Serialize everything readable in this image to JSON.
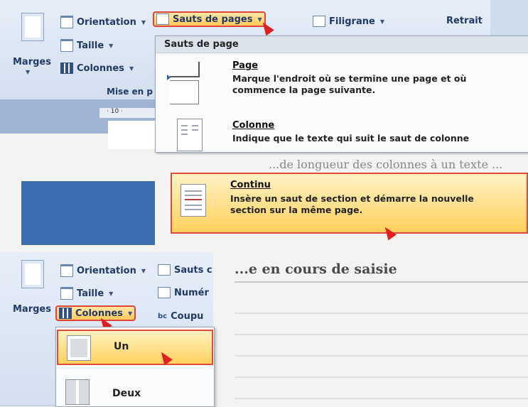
{
  "ribbon_top": {
    "orientation": "Orientation",
    "taille": "Taille",
    "colonnes": "Colonnes",
    "marges": "Marges",
    "sauts": "Sauts de pages",
    "filigrane": "Filigrane",
    "retrait": "Retrait",
    "group": "Mise en p"
  },
  "breaks_menu": {
    "header": "Sauts de page",
    "items": [
      {
        "title": "Page",
        "desc1": "Marque l'endroit où se termine une page et où",
        "desc2": "commence la page suivante."
      },
      {
        "title": "Colonne",
        "desc1": "Indique que le texte qui suit le saut de colonne",
        "desc2": ""
      },
      {
        "title": "Continu",
        "desc1": "Insère un saut de section et démarre la nouvelle",
        "desc2": "section sur la même page."
      }
    ]
  },
  "ruler": "· 10 ·",
  "ribbon_bottom": {
    "orientation": "Orientation",
    "sauts": "Sauts c",
    "taille": "Taille",
    "numer": "Numér",
    "marges": "Marges",
    "colonnes": "Colonnes",
    "coupu": "Coupu",
    "options": [
      "Un",
      "Deux"
    ]
  },
  "background_text": {
    "line1": "...de longueur des colonnes à un texte ...",
    "heading": "...e en cours de saisie"
  }
}
